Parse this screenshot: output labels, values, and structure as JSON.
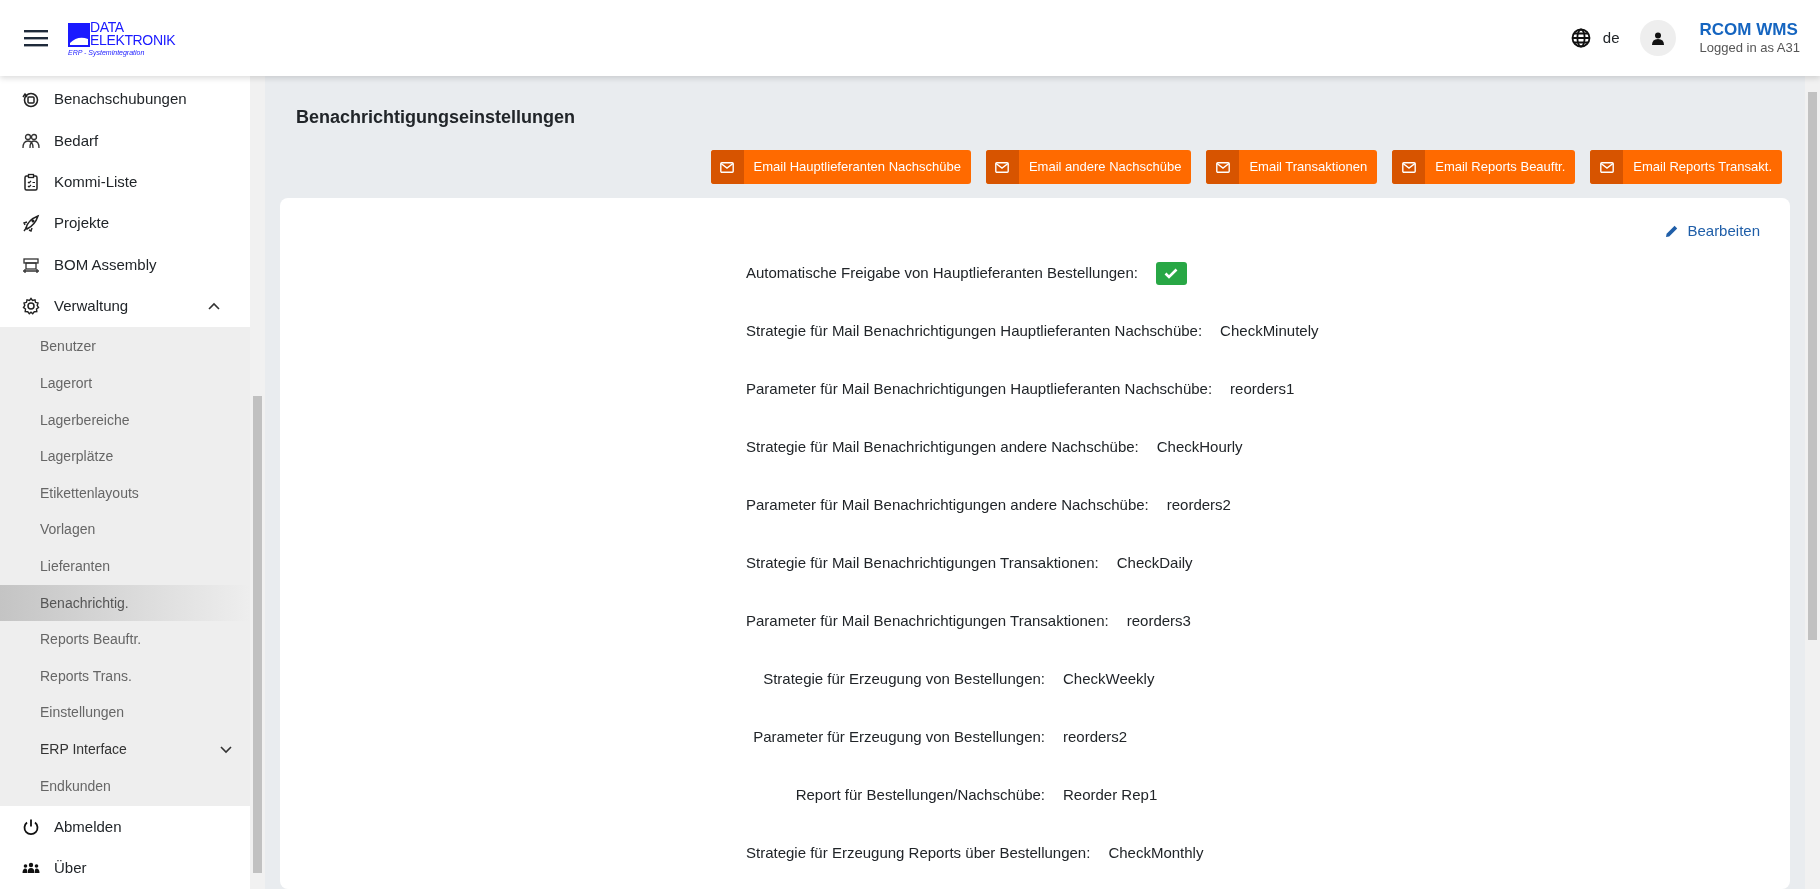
{
  "header": {
    "logo": {
      "name_line_1": "DATA",
      "name_line_2": "ELEKTRONIK",
      "tagline": "ERP - Systemintegration"
    },
    "language": "de",
    "app_name": "RCOM WMS",
    "user_status": "Logged in as A31"
  },
  "sidebar": {
    "items": [
      {
        "label": "Benachschubungen",
        "selected": false
      },
      {
        "label": "Bedarf",
        "selected": false
      },
      {
        "label": "Kommi-Liste",
        "selected": false
      },
      {
        "label": "Projekte",
        "selected": false
      },
      {
        "label": "BOM Assembly",
        "selected": false
      },
      {
        "label": "Verwaltung",
        "selected": false,
        "expanded": true,
        "children": [
          {
            "label": "Benutzer",
            "selected": false
          },
          {
            "label": "Lagerort",
            "selected": false
          },
          {
            "label": "Lagerbereiche",
            "selected": false
          },
          {
            "label": "Lagerplätze",
            "selected": false
          },
          {
            "label": "Etikettenlayouts",
            "selected": false
          },
          {
            "label": "Vorlagen",
            "selected": false
          },
          {
            "label": "Lieferanten",
            "selected": false
          },
          {
            "label": "Benachrichtig.",
            "selected": true
          },
          {
            "label": "Reports Beauftr.",
            "selected": false
          },
          {
            "label": "Reports Trans.",
            "selected": false
          },
          {
            "label": "Einstellungen",
            "selected": false
          },
          {
            "label": "ERP Interface",
            "selected": false,
            "expanded": false
          },
          {
            "label": "Endkunden",
            "selected": false
          }
        ]
      },
      {
        "label": "Abmelden",
        "selected": false
      },
      {
        "label": "Über",
        "selected": false
      }
    ]
  },
  "page": {
    "title": "Benachrichtigungseinstellungen",
    "buttons": [
      "Email Hauptlieferanten Nachschübe",
      "Email andere Nachschübe",
      "Email Transaktionen",
      "Email Reports Beauftr.",
      "Email Reports Transakt."
    ],
    "edit_link": "Bearbeiten",
    "settings": [
      {
        "kind": "checkbox",
        "label": "Automatische Freigabe von Hauptlieferanten Bestellungen:",
        "checked": true
      },
      {
        "kind": "text",
        "label": "Strategie für Mail Benachrichtigungen Hauptlieferanten Nachschübe:",
        "value": "CheckMinutely"
      },
      {
        "kind": "text",
        "label": "Parameter für Mail Benachrichtigungen Hauptlieferanten Nachschübe:",
        "value": "reorders1"
      },
      {
        "kind": "text",
        "label": "Strategie für Mail Benachrichtigungen andere Nachschübe:",
        "value": "CheckHourly"
      },
      {
        "kind": "text",
        "label": "Parameter für Mail Benachrichtigungen andere Nachschübe:",
        "value": "reorders2"
      },
      {
        "kind": "text",
        "label": "Strategie für Mail Benachrichtigungen Transaktionen:",
        "value": "CheckDaily"
      },
      {
        "kind": "text",
        "label": "Parameter für Mail Benachrichtigungen Transaktionen:",
        "value": "reorders3"
      },
      {
        "kind": "text",
        "label": "Strategie für Erzeugung von Bestellungen:",
        "value": "CheckWeekly"
      },
      {
        "kind": "text",
        "label": "Parameter für Erzeugung von Bestellungen:",
        "value": "reorders2"
      },
      {
        "kind": "text",
        "label": "Report für Bestellungen/Nachschübe:",
        "value": "Reorder Rep1"
      },
      {
        "kind": "text",
        "label": "Strategie für Erzeugung Reports über Bestellungen:",
        "value": "CheckMonthly"
      }
    ]
  }
}
